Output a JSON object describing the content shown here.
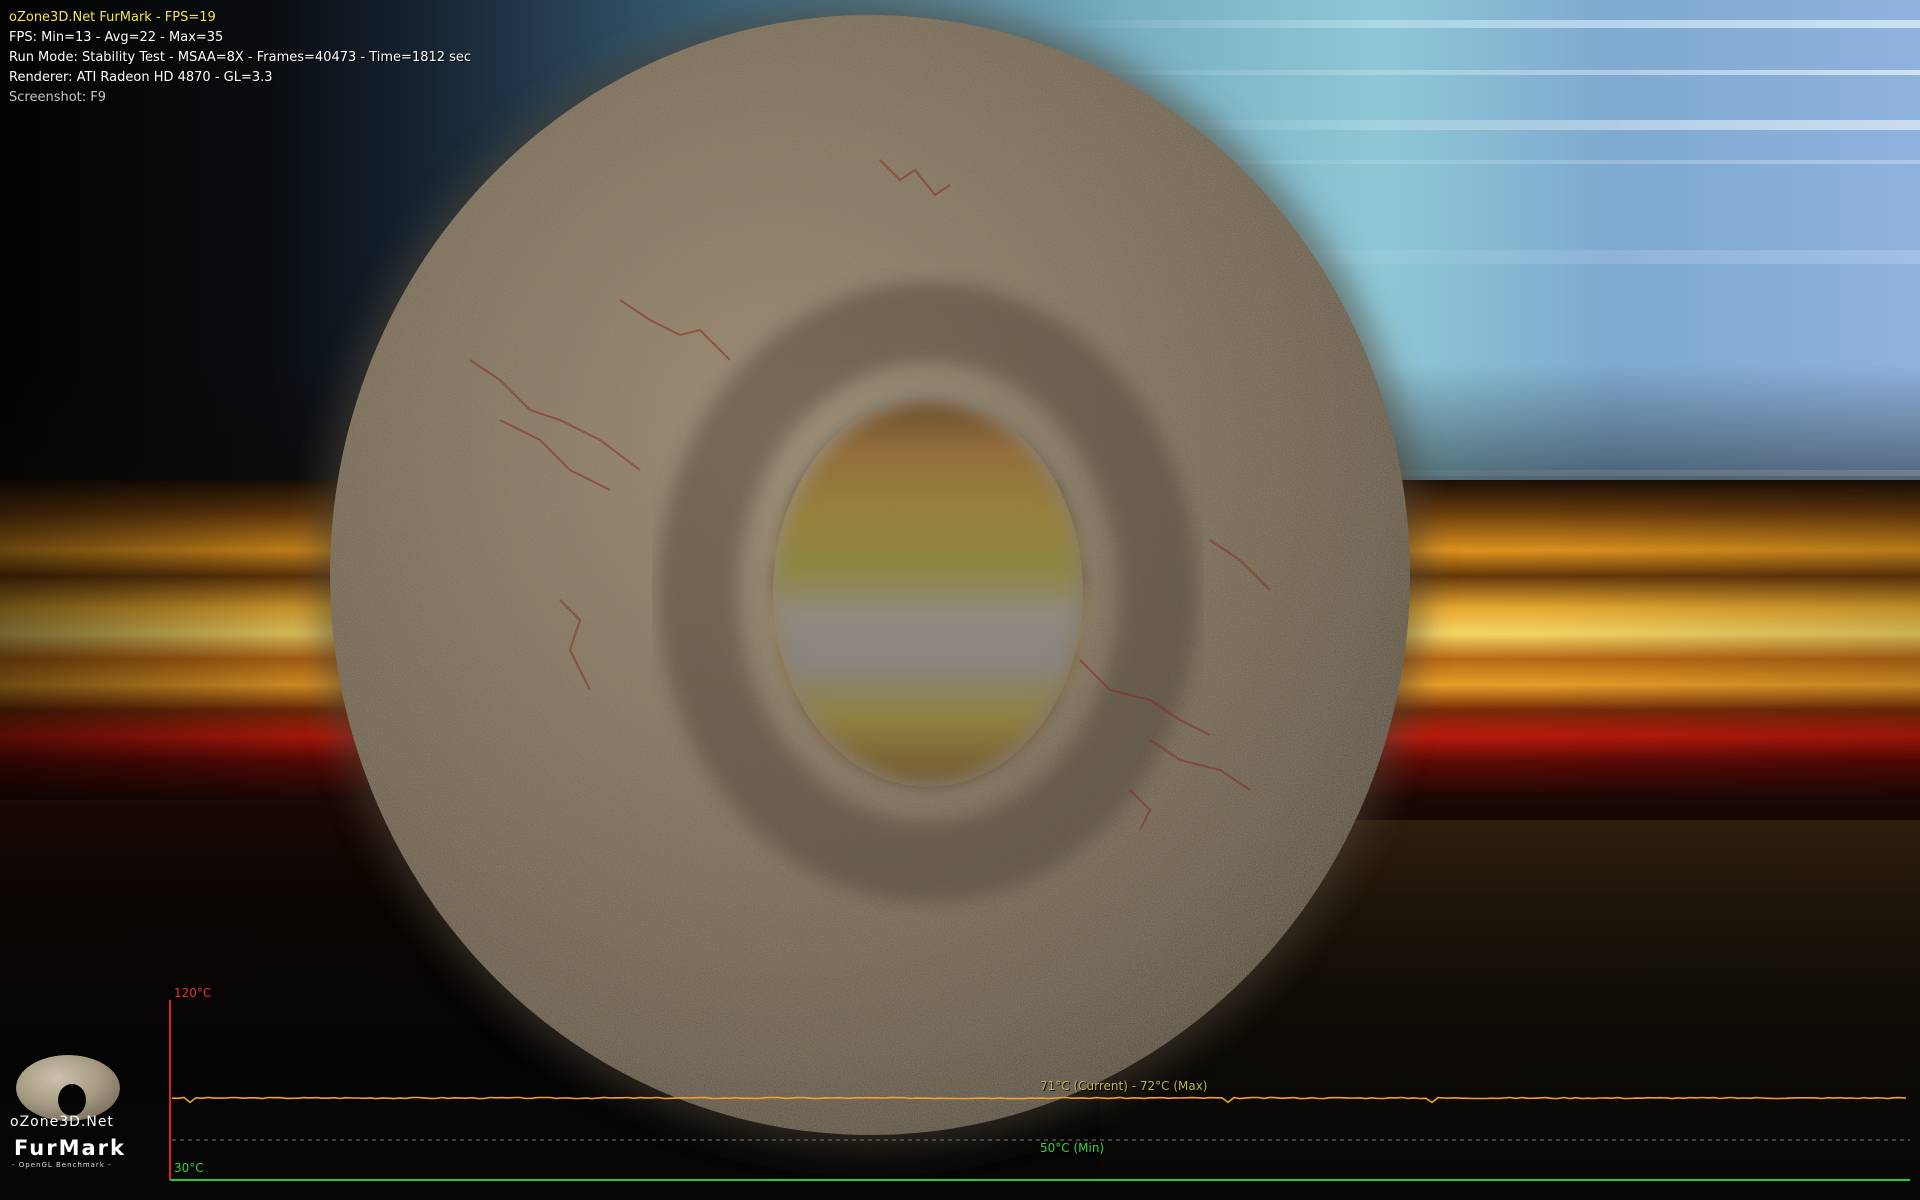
{
  "osd": {
    "title": "oZone3D.Net FurMark - FPS=19",
    "fps": "FPS: Min=13 - Avg=22 - Max=35",
    "run_mode": "Run Mode: Stability Test - MSAA=8X - Frames=40473 - Time=1812 sec",
    "renderer": "Renderer: ATI Radeon HD 4870  - GL=3.3",
    "screenshot": "Screenshot: F9"
  },
  "temperature_graph": {
    "max_label": "120°C",
    "min_label": "30°C",
    "current_max_label": "71°C (Current) - 72°C (Max)",
    "min_reading_label": "50°C (Min)",
    "axis_min_c": 30,
    "axis_max_c": 120,
    "current_c": 71,
    "max_c": 72,
    "min_c": 50,
    "colors": {
      "axis": "#dd2222",
      "baseline": "#22cc33",
      "trace": "#f0a030",
      "min_line": "#7a7a7a"
    }
  },
  "logo": {
    "site": "oZone3D.Net",
    "name": "FurMark",
    "subtitle": "- OpenGL Benchmark -"
  },
  "scene": {
    "object": "fur-torus-icon"
  }
}
